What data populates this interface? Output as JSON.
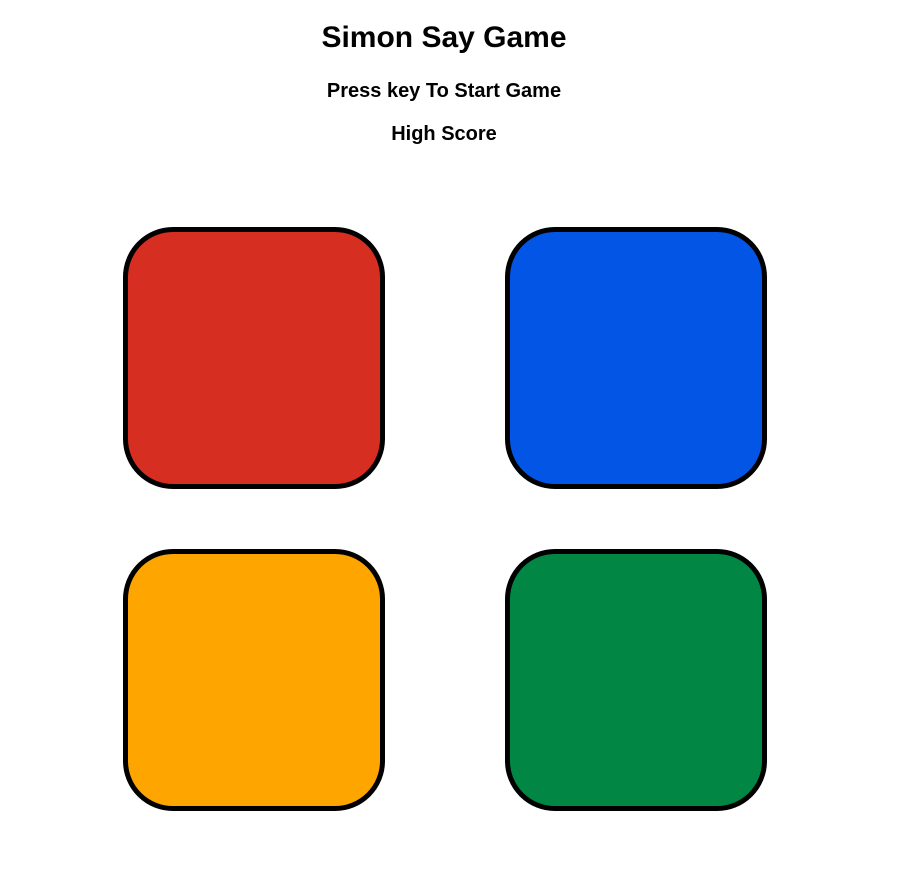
{
  "game": {
    "title": "Simon Say Game",
    "status": "Press key To Start Game",
    "high_score_label": "High Score"
  },
  "buttons": [
    {
      "id": "red",
      "color": "#d62e20"
    },
    {
      "id": "blue",
      "color": "#0355e6"
    },
    {
      "id": "yellow",
      "color": "#fea500"
    },
    {
      "id": "green",
      "color": "#018743"
    }
  ]
}
